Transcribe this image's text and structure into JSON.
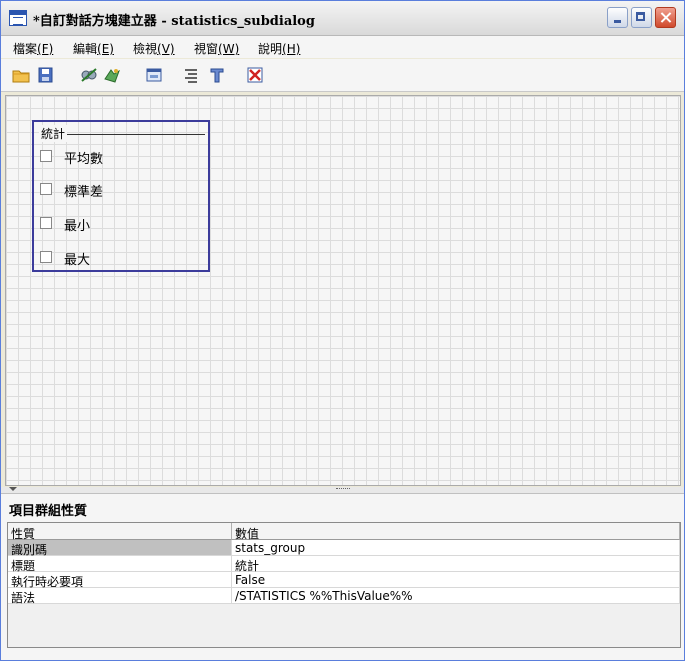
{
  "window": {
    "title": "*自訂對話方塊建立器 - statistics_subdialog"
  },
  "menubar": {
    "items": [
      {
        "label": "檔案",
        "key": "(F)"
      },
      {
        "label": "編輯",
        "key": "(E)"
      },
      {
        "label": "檢視",
        "key": "(V)"
      },
      {
        "label": "視窗",
        "key": "(W)"
      },
      {
        "label": "說明",
        "key": "(H)"
      }
    ]
  },
  "toolbar": {
    "icons": [
      "open-folder-icon",
      "save-icon",
      "preview-icon",
      "install-icon",
      "dialog-properties-icon",
      "align-icon",
      "tools-icon",
      "delete-icon"
    ]
  },
  "canvas": {
    "group": {
      "title": "統計",
      "checkboxes": [
        {
          "label": "平均數",
          "checked": false
        },
        {
          "label": "標準差",
          "checked": false
        },
        {
          "label": "最小",
          "checked": false
        },
        {
          "label": "最大",
          "checked": false
        }
      ]
    }
  },
  "properties": {
    "title": "項目群組性質",
    "columns": [
      "性質",
      "數值"
    ],
    "rows": [
      {
        "property": "識別碼",
        "value": "stats_group"
      },
      {
        "property": "標題",
        "value": "統計"
      },
      {
        "property": "執行時必要項",
        "value": "False"
      },
      {
        "property": "語法",
        "value": "/STATISTICS %%ThisValue%%"
      }
    ]
  },
  "colors": {
    "group_border": "#3b3b9b",
    "selected_cell": "#c0c0c0"
  }
}
